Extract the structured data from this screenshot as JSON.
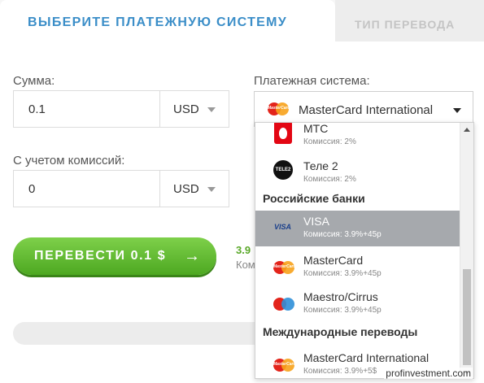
{
  "tabs": {
    "active": "ВЫБЕРИТЕ ПЛАТЕЖНУЮ СИСТЕМУ",
    "inactive": "ТИП ПЕРЕВОДА"
  },
  "form": {
    "amount_label": "Сумма:",
    "amount_value": "0.1",
    "amount_currency": "USD",
    "commission_label": "С учетом комиссий:",
    "commission_value": "0",
    "commission_currency": "USD",
    "system_label": "Платежная система:",
    "system_selected": "MasterCard International"
  },
  "transfer_button": {
    "label": "ПЕРЕВЕСТИ 0.1 $",
    "arrow": "→"
  },
  "fee_peek": {
    "line1": "3.9",
    "line2": "Ком"
  },
  "dropdown": {
    "items_top": [
      {
        "name": "МТС",
        "fee": "Комиссия: 2%",
        "icon": "mts-icon"
      },
      {
        "name": "Теле 2",
        "fee": "Комиссия: 2%",
        "icon": "tele2-icon"
      }
    ],
    "group_banks": "Российские банки",
    "items_banks": [
      {
        "name": "VISA",
        "fee": "Комиссия: 3.9%+45р",
        "icon": "visa-icon",
        "active": true
      },
      {
        "name": "MasterCard",
        "fee": "Комиссия: 3.9%+45р",
        "icon": "mastercard-icon"
      },
      {
        "name": "Maestro/Cirrus",
        "fee": "Комиссия: 3.9%+45р",
        "icon": "maestro-icon"
      }
    ],
    "group_intl": "Международные переводы",
    "items_intl": [
      {
        "name": "MasterCard International",
        "fee": "Комиссия: 3.9%+5$",
        "icon": "mastercard-icon"
      }
    ]
  },
  "icons": {
    "mastercard_text": "MasterCard",
    "tele2_text": "TELE2",
    "visa_text": "VISA"
  },
  "watermark": "profinvestment.com",
  "colors": {
    "accent_blue": "#3b8ec8",
    "button_green": "#5db52c",
    "active_option": "#a6a9ad"
  }
}
